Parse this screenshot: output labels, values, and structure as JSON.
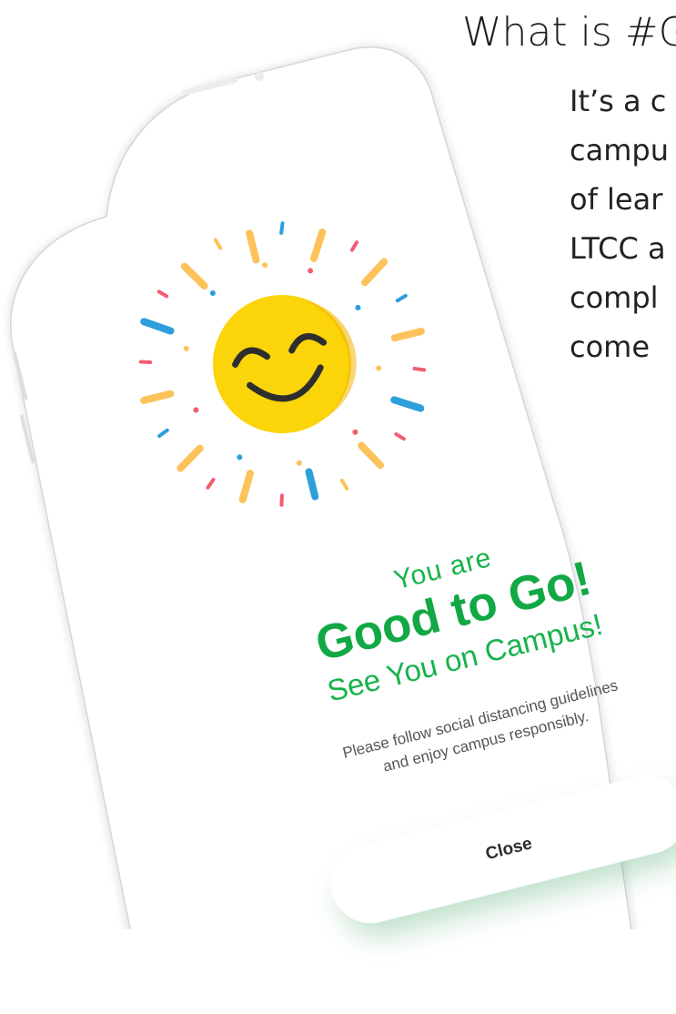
{
  "article": {
    "heading": "What is #G",
    "paragraph_lines": [
      "It’s a c",
      "campu",
      "of lear",
      "LTCC a",
      "compl",
      "come"
    ]
  },
  "app": {
    "status_line_1": "You are",
    "status_headline": "Good to Go!",
    "status_line_3": "See You on Campus!",
    "guideline_line_1": "Please follow social distancing guidelines",
    "guideline_line_2": "and enjoy campus responsibly.",
    "close_label": "Close"
  },
  "colors": {
    "accent_green": "#12a845",
    "emoji_yellow": "#fbd40a",
    "ray_blue": "#2d9fdc",
    "ray_orange": "#fdc25a",
    "ray_red": "#f25c6f"
  },
  "icons": {
    "emoji": "smiling-face-icon",
    "rays": "sunburst-confetti-icon"
  }
}
